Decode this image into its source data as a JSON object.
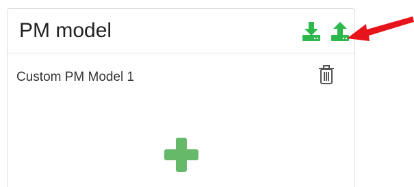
{
  "panel": {
    "title": "PM model",
    "models": [
      {
        "name": "Custom PM Model 1"
      }
    ]
  },
  "colors": {
    "action_green": "#2db84c",
    "add_green": "#67b96a",
    "trash_gray": "#555555",
    "annotation_red": "#e8141b"
  },
  "icons": {
    "download": "download-icon",
    "upload": "upload-icon",
    "delete": "trash-icon",
    "add": "plus-icon",
    "annotation": "red-arrow"
  }
}
